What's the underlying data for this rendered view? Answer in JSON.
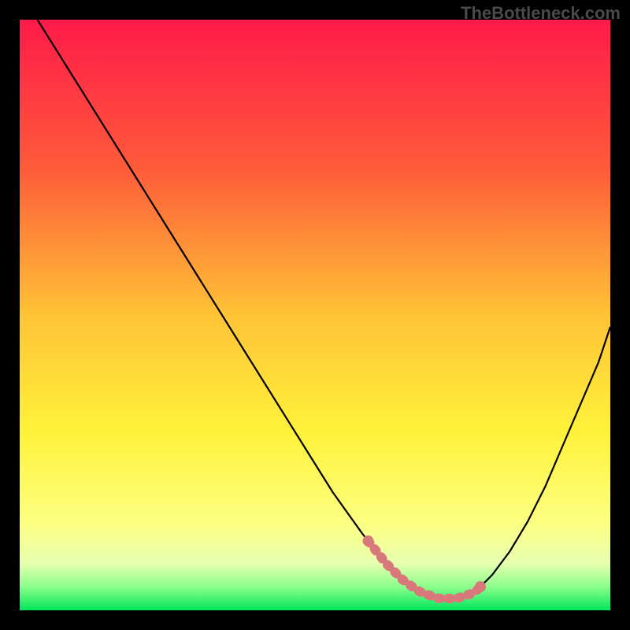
{
  "watermark": "TheBottleneck.com",
  "chart_data": {
    "type": "line",
    "title": "",
    "xlabel": "",
    "ylabel": "",
    "xlim": [
      0,
      100
    ],
    "ylim": [
      0,
      100
    ],
    "x": [
      3,
      8,
      13,
      18,
      23,
      28,
      33,
      38,
      43,
      48,
      53,
      58,
      62,
      65,
      68,
      71,
      74,
      77,
      80,
      83,
      86,
      89,
      92,
      95,
      98,
      100
    ],
    "values": [
      100,
      92,
      84,
      76,
      68,
      60,
      52,
      44,
      36,
      28,
      20,
      13,
      8,
      5,
      3,
      2,
      2,
      3,
      6,
      10,
      15,
      21,
      28,
      35,
      42,
      48
    ],
    "highlight_region": {
      "x_start": 59,
      "x_end": 78,
      "color": "#d9787a"
    },
    "background_gradient": {
      "stops": [
        {
          "offset": 0.0,
          "color": "#ff1a4a"
        },
        {
          "offset": 0.25,
          "color": "#ff5a3a"
        },
        {
          "offset": 0.5,
          "color": "#ffc336"
        },
        {
          "offset": 0.7,
          "color": "#fff23a"
        },
        {
          "offset": 0.85,
          "color": "#fdff80"
        },
        {
          "offset": 0.92,
          "color": "#e8ffb0"
        },
        {
          "offset": 0.96,
          "color": "#8cff8c"
        },
        {
          "offset": 1.0,
          "color": "#00e65c"
        }
      ]
    }
  }
}
